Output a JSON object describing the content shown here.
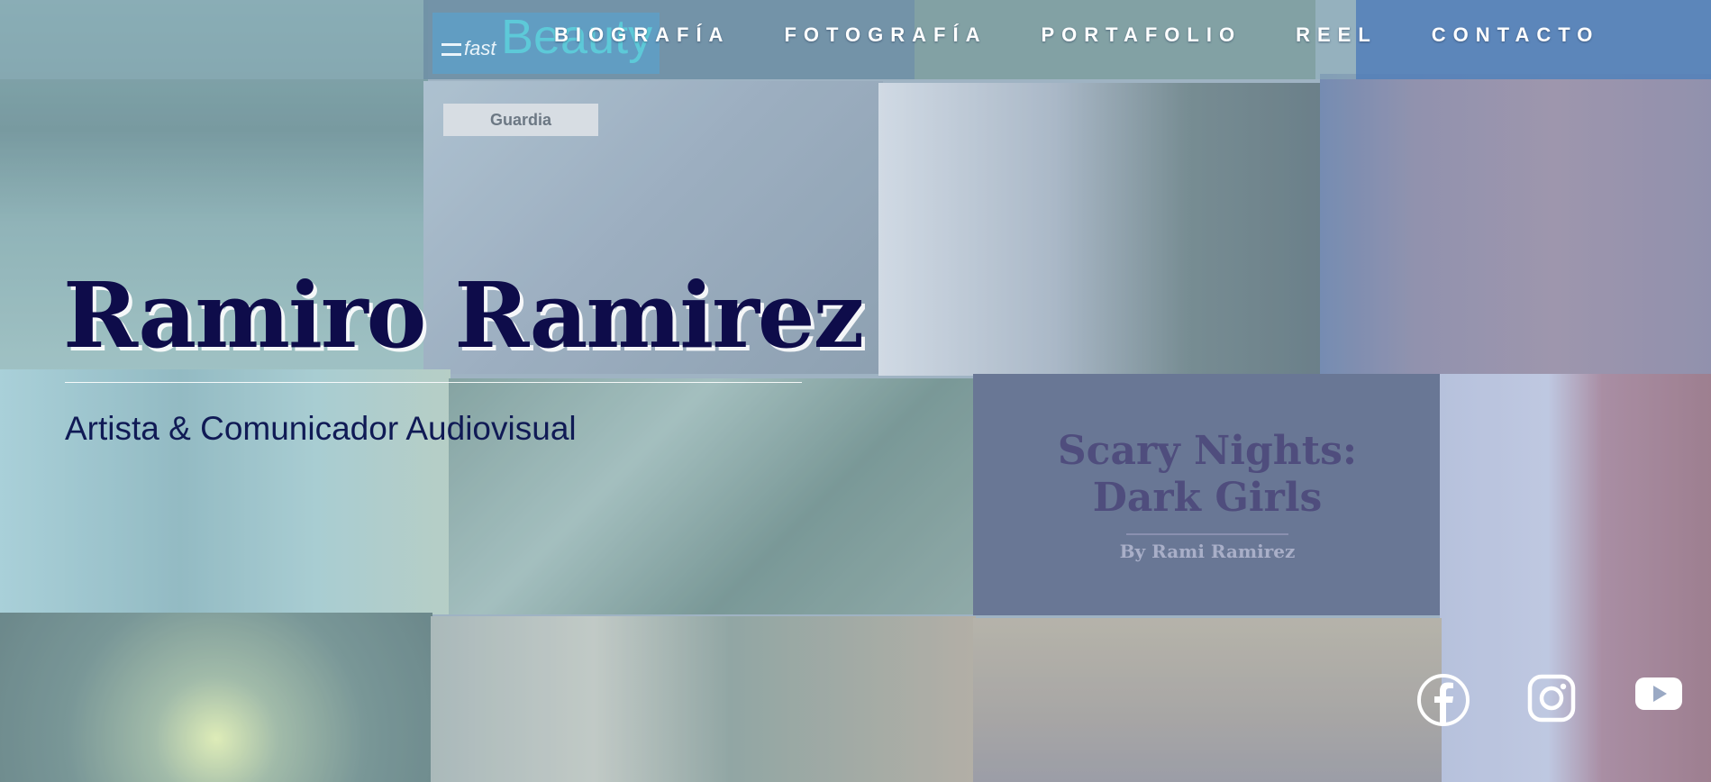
{
  "nav": {
    "items": [
      {
        "label": "BIOGRAFÍA"
      },
      {
        "label": "FOTOGRAFÍA"
      },
      {
        "label": "PORTAFOLIO"
      },
      {
        "label": "REEL"
      },
      {
        "label": "CONTACTO"
      }
    ]
  },
  "hero": {
    "name": "Ramiro Ramirez",
    "subtitle": "Artista & Comunicador Audiovisual"
  },
  "collage": {
    "logo_fast": "fast",
    "logo_beauty": "Beauty",
    "sign_guardia": "Guardia",
    "poster_title_line1": "Scary Nights:",
    "poster_title_line2": "Dark Girls",
    "poster_by": "By Rami Ramirez"
  },
  "social": {
    "icons": [
      "facebook-icon",
      "instagram-icon",
      "youtube-icon"
    ]
  },
  "colors": {
    "title": "#0e0c4a",
    "subtitle": "#101a55",
    "nav_text": "#ffffff"
  }
}
